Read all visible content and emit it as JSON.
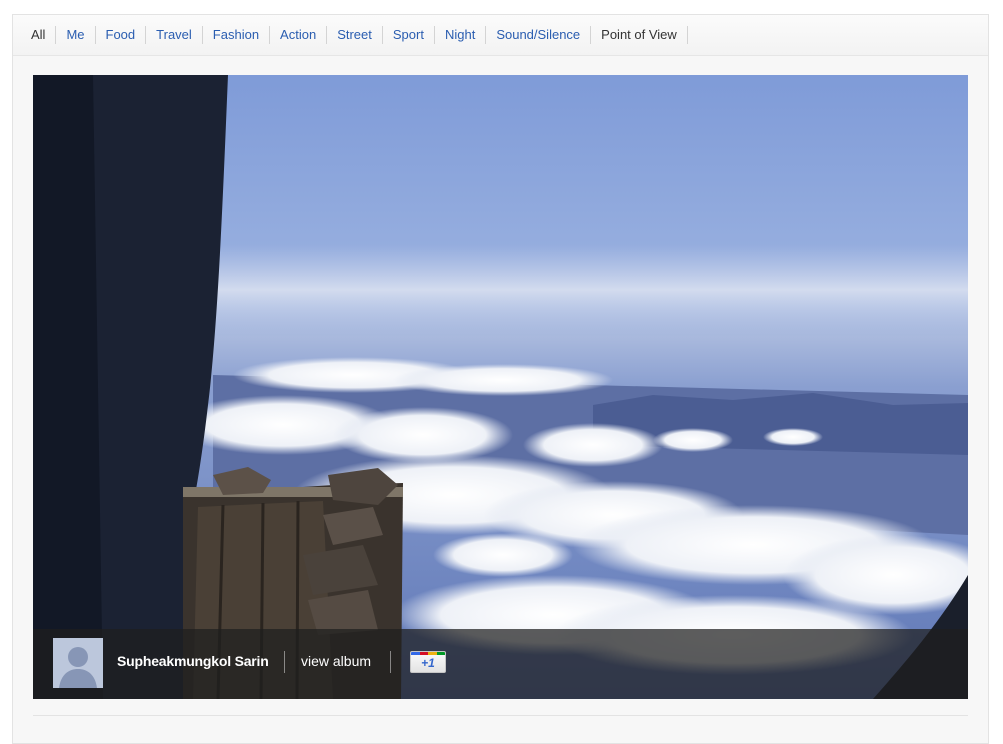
{
  "tabs": [
    {
      "label": "All",
      "state": "active"
    },
    {
      "label": "Me",
      "state": "link"
    },
    {
      "label": "Food",
      "state": "link"
    },
    {
      "label": "Travel",
      "state": "link"
    },
    {
      "label": "Fashion",
      "state": "link"
    },
    {
      "label": "Action",
      "state": "link"
    },
    {
      "label": "Street",
      "state": "link"
    },
    {
      "label": "Sport",
      "state": "link"
    },
    {
      "label": "Night",
      "state": "link"
    },
    {
      "label": "Sound/Silence",
      "state": "link"
    },
    {
      "label": "Point of View",
      "state": "plain"
    }
  ],
  "photo": {
    "author_name": "Supheakmungkol Sarin",
    "view_album_label": "view album",
    "plusone_label": "+1",
    "avatar_icon": "default-user-silhouette-icon"
  },
  "colors": {
    "link": "#2a5db0",
    "active_tab": "#333333",
    "plusone_text": "#3366cc",
    "google_stripe": [
      "#3369e8",
      "#d50f25",
      "#eeb211",
      "#009925"
    ]
  }
}
